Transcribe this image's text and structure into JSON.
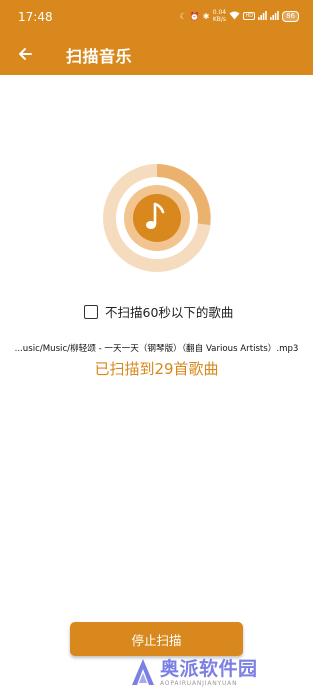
{
  "status_bar": {
    "time": "17:48",
    "net_speed": "0.04 KB/s",
    "battery": "86"
  },
  "app_bar": {
    "title": "扫描音乐",
    "back_icon": "arrow-left-icon"
  },
  "scan": {
    "checkbox_label": "不扫描60秒以下的歌曲",
    "checkbox_checked": false,
    "current_file": "...usic/Music/柳轻颂 - 一天一天（钢琴版）（翻自 Various Artists）.mp3",
    "count_text": "已扫描到29首歌曲"
  },
  "actions": {
    "stop_label": "停止扫描"
  },
  "watermark": {
    "cn": "奥派软件园",
    "en": "AOPAIRUANJIANYUAN"
  },
  "colors": {
    "accent": "#d8881c",
    "accent_light": "#f6dcbe",
    "text": "#222222"
  }
}
